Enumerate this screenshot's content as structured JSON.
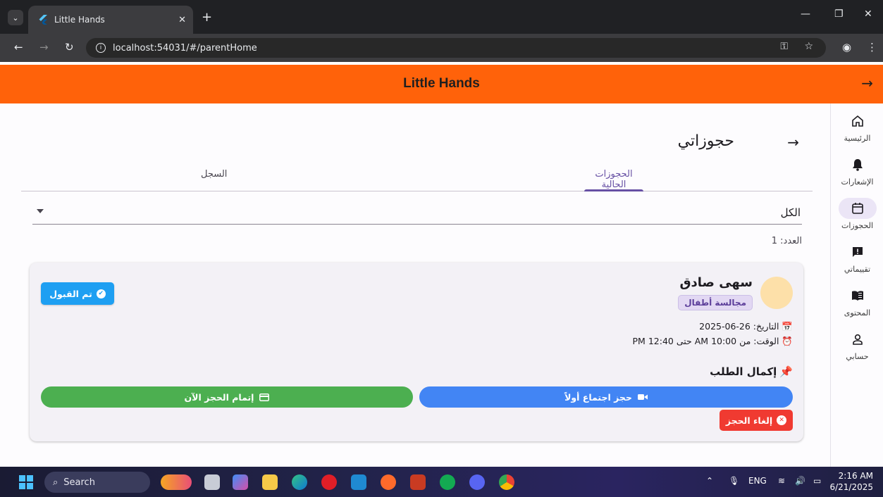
{
  "browser": {
    "tab_title": "Little Hands",
    "url": "localhost:54031/#/parentHome"
  },
  "app": {
    "title": "Little Hands"
  },
  "rail": {
    "items": [
      {
        "label": "الرئيسية",
        "icon": "home-icon"
      },
      {
        "label": "الإشعارات",
        "icon": "bell-icon"
      },
      {
        "label": "الحجوزات",
        "icon": "calendar-icon",
        "active": true
      },
      {
        "label": "تقييماتي",
        "icon": "feedback-icon"
      },
      {
        "label": "المحتوى",
        "icon": "book-icon"
      },
      {
        "label": "حسابي",
        "icon": "person-icon"
      }
    ]
  },
  "page": {
    "title": "حجوزاتي",
    "tabs": [
      "الحجوزات الحالية",
      "السجل"
    ],
    "filter_value": "الكل",
    "count_label": "العدد: 1"
  },
  "booking": {
    "name": "سهى صادق",
    "role": "مجالسة أطفال",
    "date_line": "📅 التاريخ: 26-06-2025",
    "time_line": "⏰ الوقت: من 10:00 AM حتى 12:40 PM",
    "status": "تم القبول",
    "section_title": "إكمال الطلب",
    "meeting_button": "حجز اجتماع أولاً",
    "complete_button": "إتمام الحجز الآن",
    "cancel_button": "إلغاء الحجز"
  },
  "taskbar": {
    "search_placeholder": "Search",
    "language": "ENG",
    "time": "2:16 AM",
    "date": "6/21/2025"
  },
  "colors": {
    "appbar": "#ff620a",
    "accent": "#6750a4",
    "status_accepted": "#1e9ff2",
    "meeting_button": "#4285f4",
    "complete_button": "#4caf50",
    "cancel_button": "#f03a31"
  }
}
